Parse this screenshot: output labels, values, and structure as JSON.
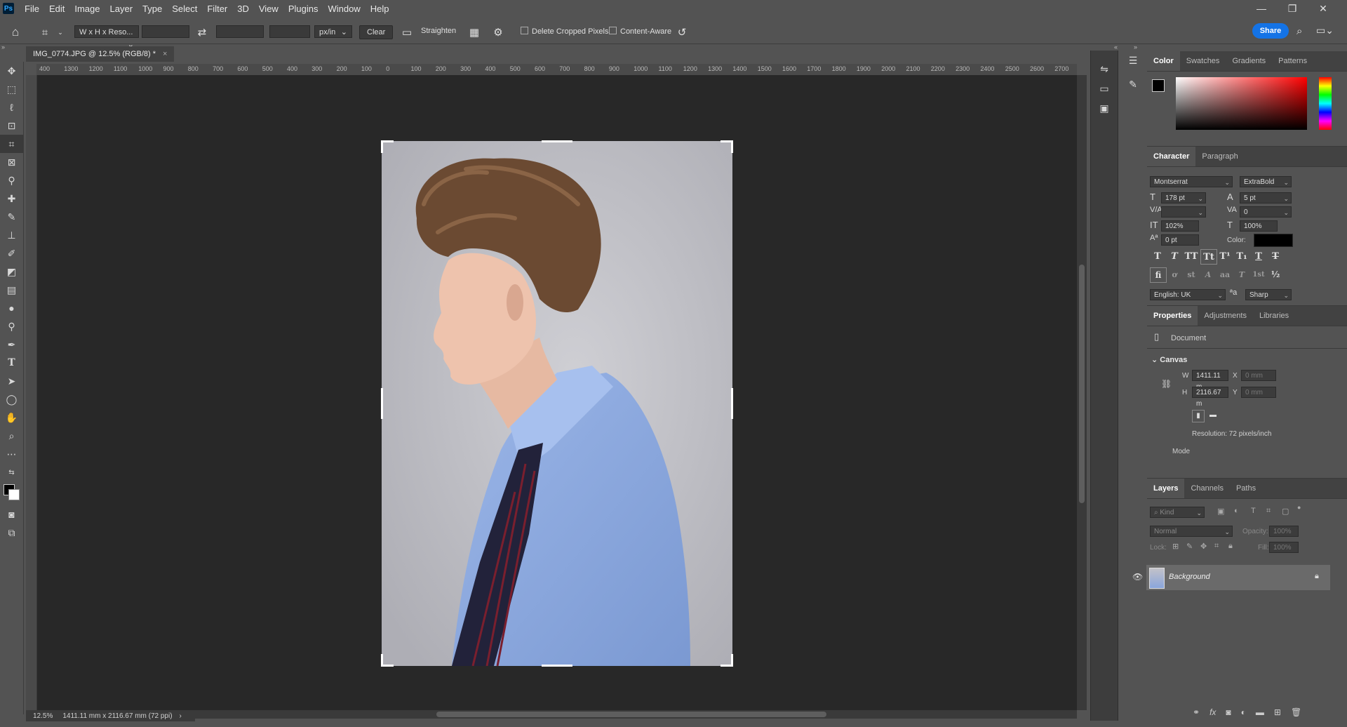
{
  "app": {
    "logo": "Ps"
  },
  "menu": [
    "File",
    "Edit",
    "Image",
    "Layer",
    "Type",
    "Select",
    "Filter",
    "3D",
    "View",
    "Plugins",
    "Window",
    "Help"
  ],
  "window_controls": {
    "minimize": "—",
    "restore": "❐",
    "close": "✕"
  },
  "options_bar": {
    "ratio_preset": "W x H x Reso...",
    "width_value": "",
    "height_value": "",
    "resolution_value": "",
    "units": "px/in",
    "clear_label": "Clear",
    "straighten_label": "Straighten",
    "delete_cropped_label": "Delete Cropped Pixels",
    "content_aware_label": "Content-Aware",
    "share_label": "Share"
  },
  "document": {
    "tab_title": "IMG_0774.JPG @ 12.5% (RGB/8) *",
    "close_glyph": "×"
  },
  "ruler_h_labels": [
    "400",
    "1300",
    "1200",
    "1100",
    "1000",
    "900",
    "800",
    "700",
    "600",
    "500",
    "400",
    "300",
    "200",
    "100",
    "0",
    "100",
    "200",
    "300",
    "400",
    "500",
    "600",
    "700",
    "800",
    "900",
    "1000",
    "1100",
    "1200",
    "1300",
    "1400",
    "1500",
    "1600",
    "1700",
    "1800",
    "1900",
    "2000",
    "2100",
    "2200",
    "2300",
    "2400",
    "2500",
    "2600",
    "2700"
  ],
  "status": {
    "zoom": "12.5%",
    "info": "1411.11 mm x 2116.67 mm (72 ppi)"
  },
  "color_panel": {
    "tabs": [
      "Color",
      "Swatches",
      "Gradients",
      "Patterns"
    ],
    "active": "Color"
  },
  "character_panel": {
    "tabs": [
      "Character",
      "Paragraph"
    ],
    "font_family": "Montserrat",
    "font_style": "ExtraBold",
    "font_size": "178 pt",
    "leading": "5 pt",
    "kerning": "",
    "tracking": "0",
    "vertical_scale": "102%",
    "horizontal_scale": "100%",
    "baseline_shift": "0 pt",
    "color_label": "Color:",
    "color_value": "#000000",
    "language": "English: UK",
    "antialias": "Sharp",
    "aa_icon": "ªa",
    "type_buttons": [
      "T",
      "T",
      "TT",
      "Tt",
      "T¹",
      "T₁",
      "T",
      "T"
    ],
    "opentype_buttons": [
      "ﬁ",
      "ơ",
      "st",
      "A",
      "aa",
      "T",
      "1st",
      "½"
    ]
  },
  "properties_panel": {
    "tabs": [
      "Properties",
      "Adjustments",
      "Libraries"
    ],
    "document_label": "Document",
    "canvas_label": "Canvas",
    "w_label": "W",
    "h_label": "H",
    "x_label": "X",
    "y_label": "Y",
    "width": "1411.11 m",
    "height": "2116.67 m",
    "x_value": "0 mm",
    "y_value": "0 mm",
    "resolution": "Resolution: 72 pixels/inch",
    "mode_label": "Mode"
  },
  "layers_panel": {
    "tabs": [
      "Layers",
      "Channels",
      "Paths"
    ],
    "filter_placeholder": "Kind",
    "blend_mode": "Normal",
    "opacity_label": "Opacity:",
    "opacity_value": "100%",
    "lock_label": "Lock:",
    "fill_label": "Fill:",
    "fill_value": "100%",
    "layers": [
      {
        "name": "Background",
        "visible": true,
        "locked": true
      }
    ]
  },
  "colors": {
    "accent": "#1473e6",
    "ui_bg": "#535353",
    "canvas_bg": "#282828"
  }
}
